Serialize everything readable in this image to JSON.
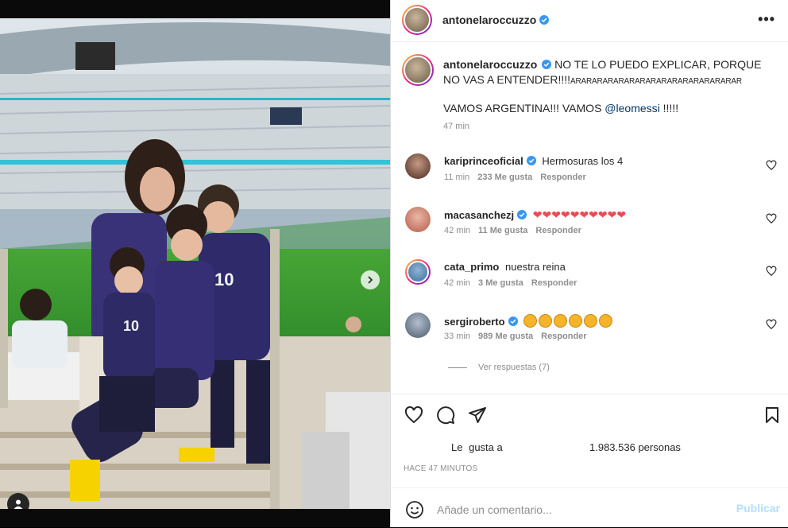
{
  "post": {
    "author": "antonelaroccuzzo",
    "verified": true,
    "more_label": "•••"
  },
  "caption": {
    "username": "antonelaroccuzzo",
    "text_main": "NO TE LO PUEDO EXPLICAR, PORQUE NO VAS A ENTENDER!!!!",
    "text_tail": "ARARARARARARARARARARARARARARARAR",
    "line2_prefix": "VAMOS ARGENTINA!!! VAMOS ",
    "line2_mention": "@leomessi",
    "line2_suffix": " !!!!!",
    "time": "47 min"
  },
  "comments": [
    {
      "username": "kariprinceoficial",
      "verified": true,
      "text": "Hermosuras los 4",
      "time": "11 min",
      "likes": "233 Me gusta",
      "reply": "Responder",
      "avatar_color": "#4a2a1f"
    },
    {
      "username": "macasanchezj",
      "verified": true,
      "text": "❤❤❤❤❤❤❤❤❤❤",
      "time": "42 min",
      "likes": "11 Me gusta",
      "reply": "Responder",
      "avatar_color": "#b85a4a"
    },
    {
      "username": "cata_primo",
      "verified": false,
      "text": "nuestra reina",
      "time": "42 min",
      "likes": "3 Me gusta",
      "reply": "Responder",
      "avatar_color": "#3c6f9a"
    },
    {
      "username": "sergiroberto",
      "verified": true,
      "text": "",
      "time": "33 min",
      "likes": "989 Me gusta",
      "reply": "Responder",
      "avatar_color": "#4a5a6e",
      "claps": 6
    }
  ],
  "replies_label": "Ver respuestas (7)",
  "likes_summary": {
    "prefix": "Le",
    "middle": "gusta a",
    "count": "1.983.536 personas"
  },
  "timestamp": "HACE 47 MINUTOS",
  "add_comment": {
    "placeholder": "Añade un comentario...",
    "publish": "Publicar"
  },
  "colors": {
    "verified": "#3897f0",
    "heart": "#ed4956",
    "link": "#00376b",
    "publish_disabled": "#b2dffc"
  },
  "icons": [
    "heart-icon",
    "comment-icon",
    "share-icon",
    "bookmark-icon",
    "emoji-icon",
    "verified-icon",
    "more-icon",
    "chevron-right-icon",
    "user-tag-icon"
  ]
}
